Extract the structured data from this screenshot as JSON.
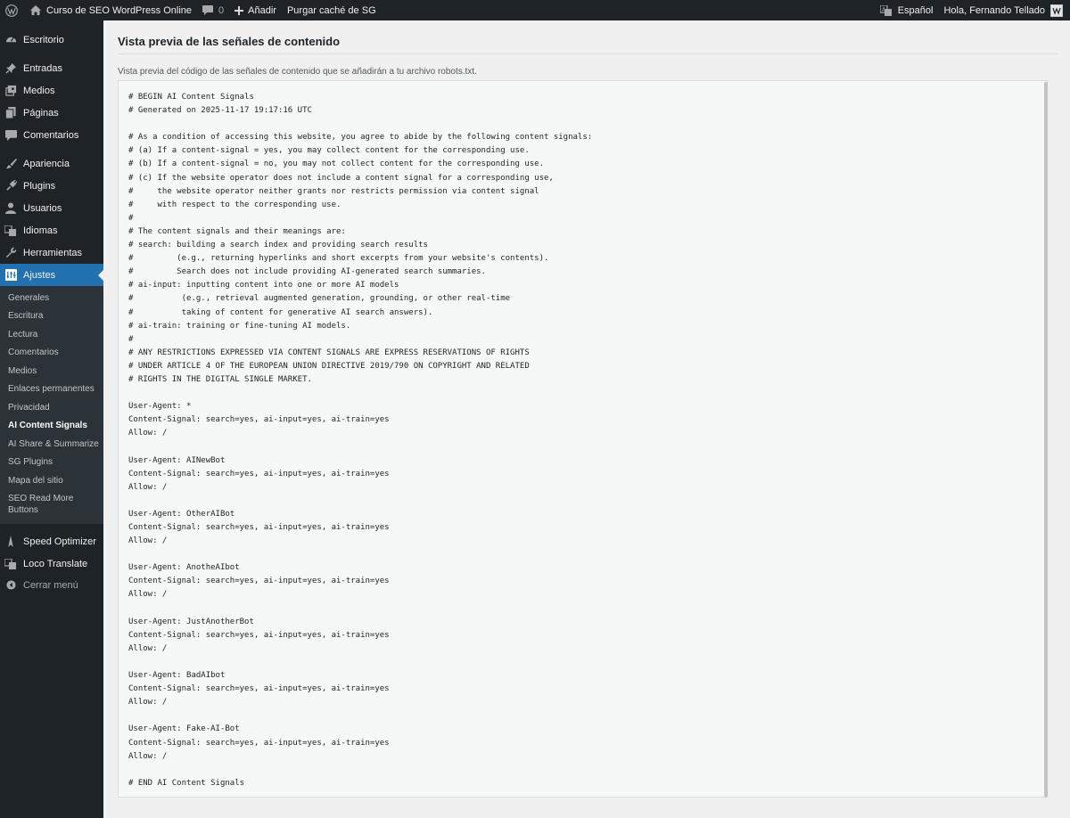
{
  "adminbar": {
    "site_name": "Curso de SEO WordPress Online",
    "comments_count": "0",
    "add_label": "Añadir",
    "purge_label": "Purgar caché de SG",
    "language": "Español",
    "greeting": "Hola, Fernando Tellado"
  },
  "sidebar": {
    "items": [
      {
        "label": "Escritorio",
        "icon": "dashboard-icon"
      },
      {
        "label": "Entradas",
        "icon": "pin-icon"
      },
      {
        "label": "Medios",
        "icon": "media-icon"
      },
      {
        "label": "Páginas",
        "icon": "page-icon"
      },
      {
        "label": "Comentarios",
        "icon": "comment-icon"
      },
      {
        "label": "Apariencia",
        "icon": "brush-icon"
      },
      {
        "label": "Plugins",
        "icon": "plugin-icon"
      },
      {
        "label": "Usuarios",
        "icon": "user-icon"
      },
      {
        "label": "Idiomas",
        "icon": "translate-icon"
      },
      {
        "label": "Herramientas",
        "icon": "wrench-icon"
      },
      {
        "label": "Ajustes",
        "icon": "settings-icon"
      }
    ],
    "submenu": [
      "Generales",
      "Escritura",
      "Lectura",
      "Comentarios",
      "Medios",
      "Enlaces permanentes",
      "Privacidad",
      "AI Content Signals",
      "AI Share & Summarize",
      "SG Plugins",
      "Mapa del sitio",
      "SEO Read More Buttons"
    ],
    "lower_items": [
      {
        "label": "Speed Optimizer",
        "icon": "speed-icon"
      },
      {
        "label": "Loco Translate",
        "icon": "translate-icon"
      },
      {
        "label": "Cerrar menú",
        "icon": "collapse-icon"
      }
    ]
  },
  "main": {
    "title": "Vista previa de las señales de contenido",
    "description": "Vista previa del código de las señales de contenido que se añadirán a tu archivo robots.txt.",
    "code": "# BEGIN AI Content Signals\n# Generated on 2025-11-17 19:17:16 UTC\n\n# As a condition of accessing this website, you agree to abide by the following content signals:\n# (a) If a content-signal = yes, you may collect content for the corresponding use.\n# (b) If a content-signal = no, you may not collect content for the corresponding use.\n# (c) If the website operator does not include a content signal for a corresponding use,\n#     the website operator neither grants nor restricts permission via content signal\n#     with respect to the corresponding use.\n#\n# The content signals and their meanings are:\n# search: building a search index and providing search results\n#         (e.g., returning hyperlinks and short excerpts from your website's contents).\n#         Search does not include providing AI-generated search summaries.\n# ai-input: inputting content into one or more AI models\n#          (e.g., retrieval augmented generation, grounding, or other real-time\n#          taking of content for generative AI search answers).\n# ai-train: training or fine-tuning AI models.\n#\n# ANY RESTRICTIONS EXPRESSED VIA CONTENT SIGNALS ARE EXPRESS RESERVATIONS OF RIGHTS\n# UNDER ARTICLE 4 OF THE EUROPEAN UNION DIRECTIVE 2019/790 ON COPYRIGHT AND RELATED\n# RIGHTS IN THE DIGITAL SINGLE MARKET.\n\nUser-Agent: *\nContent-Signal: search=yes, ai-input=yes, ai-train=yes\nAllow: /\n\nUser-Agent: AINewBot\nContent-Signal: search=yes, ai-input=yes, ai-train=yes\nAllow: /\n\nUser-Agent: OtherAIBot\nContent-Signal: search=yes, ai-input=yes, ai-train=yes\nAllow: /\n\nUser-Agent: AnotheAIbot\nContent-Signal: search=yes, ai-input=yes, ai-train=yes\nAllow: /\n\nUser-Agent: JustAnotherBot\nContent-Signal: search=yes, ai-input=yes, ai-train=yes\nAllow: /\n\nUser-Agent: BadAIbot\nContent-Signal: search=yes, ai-input=yes, ai-train=yes\nAllow: /\n\nUser-Agent: Fake-AI-Bot\nContent-Signal: search=yes, ai-input=yes, ai-train=yes\nAllow: /\n\n# END AI Content Signals"
  },
  "colors": {
    "adminbar_bg": "#1d2327",
    "sidebar_bg": "#1d2327",
    "submenu_bg": "#2c3338",
    "accent": "#2271b1",
    "page_bg": "#f0f0f1"
  }
}
